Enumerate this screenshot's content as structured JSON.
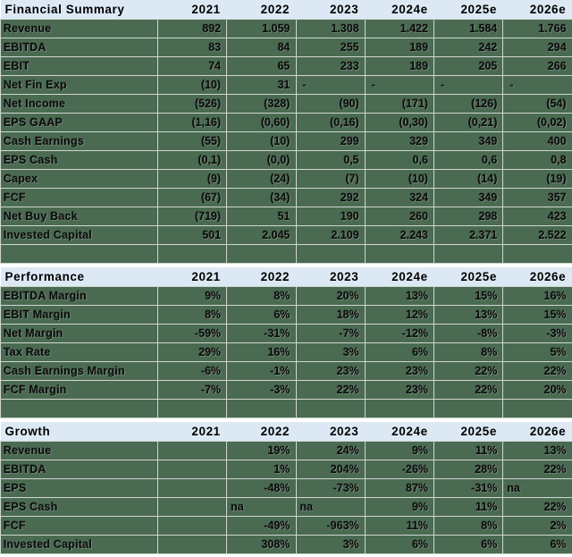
{
  "sections": [
    {
      "title": "Financial Summary",
      "years": [
        "2021",
        "2022",
        "2023",
        "2024e",
        "2025e",
        "2026e"
      ],
      "rows": [
        {
          "label": "Revenue",
          "values": [
            "892",
            "1.059",
            "1.308",
            "1.422",
            "1.584",
            "1.766"
          ]
        },
        {
          "label": "EBITDA",
          "values": [
            "83",
            "84",
            "255",
            "189",
            "242",
            "294"
          ]
        },
        {
          "label": "EBIT",
          "values": [
            "74",
            "65",
            "233",
            "189",
            "205",
            "266"
          ]
        },
        {
          "label": "Net Fin Exp",
          "values": [
            "(10)",
            "31",
            "-",
            "-",
            "-",
            "-"
          ]
        },
        {
          "label": "Net Income",
          "values": [
            "(526)",
            "(328)",
            "(90)",
            "(171)",
            "(126)",
            "(54)"
          ]
        },
        {
          "label": "EPS GAAP",
          "values": [
            "(1,16)",
            "(0,60)",
            "(0,16)",
            "(0,30)",
            "(0,21)",
            "(0,02)"
          ]
        },
        {
          "label": "Cash Earnings",
          "values": [
            "(55)",
            "(10)",
            "299",
            "329",
            "349",
            "400"
          ]
        },
        {
          "label": "EPS Cash",
          "values": [
            "(0,1)",
            "(0,0)",
            "0,5",
            "0,6",
            "0,6",
            "0,8"
          ]
        },
        {
          "label": "Capex",
          "values": [
            "(9)",
            "(24)",
            "(7)",
            "(10)",
            "(14)",
            "(19)"
          ]
        },
        {
          "label": "FCF",
          "values": [
            "(67)",
            "(34)",
            "292",
            "324",
            "349",
            "357"
          ]
        },
        {
          "label": "Net Buy Back",
          "values": [
            "(719)",
            "51",
            "190",
            "260",
            "298",
            "423"
          ]
        },
        {
          "label": "Invested Capital",
          "values": [
            "501",
            "2.045",
            "2.109",
            "2.243",
            "2.371",
            "2.522"
          ]
        }
      ]
    },
    {
      "title": "Performance",
      "years": [
        "2021",
        "2022",
        "2023",
        "2024e",
        "2025e",
        "2026e"
      ],
      "rows": [
        {
          "label": "EBITDA Margin",
          "values": [
            "9%",
            "8%",
            "20%",
            "13%",
            "15%",
            "16%"
          ]
        },
        {
          "label": "EBIT Margin",
          "values": [
            "8%",
            "6%",
            "18%",
            "12%",
            "13%",
            "15%"
          ]
        },
        {
          "label": "Net Margin",
          "values": [
            "-59%",
            "-31%",
            "-7%",
            "-12%",
            "-8%",
            "-3%"
          ]
        },
        {
          "label": "Tax Rate",
          "values": [
            "29%",
            "16%",
            "3%",
            "6%",
            "8%",
            "5%"
          ]
        },
        {
          "label": "Cash Earnings Margin",
          "values": [
            "-6%",
            "-1%",
            "23%",
            "23%",
            "22%",
            "22%"
          ]
        },
        {
          "label": "FCF Margin",
          "values": [
            "-7%",
            "-3%",
            "22%",
            "23%",
            "22%",
            "20%"
          ]
        }
      ]
    },
    {
      "title": "Growth",
      "years": [
        "2021",
        "2022",
        "2023",
        "2024e",
        "2025e",
        "2026e"
      ],
      "rows": [
        {
          "label": "Revenue",
          "values": [
            "",
            "19%",
            "24%",
            "9%",
            "11%",
            "13%"
          ]
        },
        {
          "label": "EBITDA",
          "values": [
            "",
            "1%",
            "204%",
            "-26%",
            "28%",
            "22%"
          ]
        },
        {
          "label": "EPS",
          "values": [
            "",
            "-48%",
            "-73%",
            "87%",
            "-31%",
            "na"
          ]
        },
        {
          "label": "EPS Cash",
          "values": [
            "",
            "na",
            "na",
            "9%",
            "11%",
            "22%"
          ]
        },
        {
          "label": "FCF",
          "values": [
            "",
            "-49%",
            "-963%",
            "11%",
            "8%",
            "2%"
          ]
        },
        {
          "label": "Invested Capital",
          "values": [
            "",
            "308%",
            "3%",
            "6%",
            "6%",
            "6%"
          ]
        }
      ]
    }
  ],
  "colors": {
    "header_band": "#dce9f5",
    "cell_green": "#4a6b52",
    "grid_line": "#cfd6d2",
    "text": "#0d0d0d"
  }
}
